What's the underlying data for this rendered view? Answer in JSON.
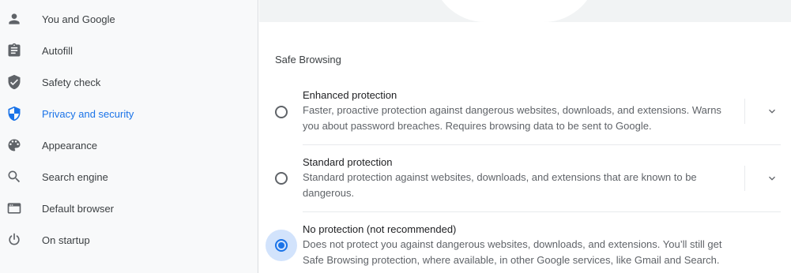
{
  "sidebar": {
    "items": [
      {
        "label": "You and Google",
        "icon": "person-icon"
      },
      {
        "label": "Autofill",
        "icon": "clipboard-icon"
      },
      {
        "label": "Safety check",
        "icon": "shield-check-icon"
      },
      {
        "label": "Privacy and security",
        "icon": "shield-half-icon",
        "active": true
      },
      {
        "label": "Appearance",
        "icon": "palette-icon"
      },
      {
        "label": "Search engine",
        "icon": "search-icon"
      },
      {
        "label": "Default browser",
        "icon": "browser-icon"
      },
      {
        "label": "On startup",
        "icon": "power-icon"
      }
    ]
  },
  "main": {
    "section_title": "Safe Browsing",
    "options": [
      {
        "title": "Enhanced protection",
        "description": "Faster, proactive protection against dangerous websites, downloads, and extensions. Warns you about password breaches. Requires browsing data to be sent to Google.",
        "selected": false
      },
      {
        "title": "Standard protection",
        "description": "Standard protection against websites, downloads, and extensions that are known to be dangerous.",
        "selected": false
      },
      {
        "title": "No protection (not recommended)",
        "description": "Does not protect you against dangerous websites, downloads, and extensions. You’ll still get Safe Browsing protection, where available, in other Google services, like Gmail and Search.",
        "selected": true
      }
    ]
  },
  "colors": {
    "accent": "#1a73e8",
    "icon": "#5f6368",
    "sidebar_bg": "#f8f9fa"
  }
}
